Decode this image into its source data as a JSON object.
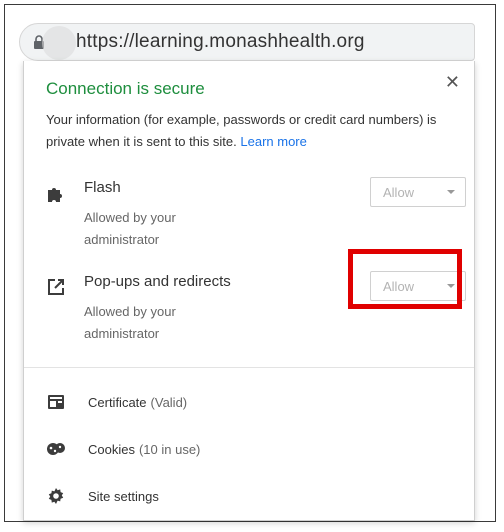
{
  "url": "https://learning.monashhealth.org",
  "panel": {
    "title": "Connection is secure",
    "description": "Your information (for example, passwords or credit card numbers) is private when it is sent to this site.",
    "learn_more": "Learn more",
    "close_glyph": "✕"
  },
  "permissions": [
    {
      "name": "Flash",
      "icon": "puzzle-piece-icon",
      "sub": "Allowed by your administrator",
      "value": "Allow"
    },
    {
      "name": "Pop-ups and redirects",
      "icon": "external-link-icon",
      "sub": "Allowed by your administrator",
      "value": "Allow"
    }
  ],
  "links": [
    {
      "label": "Certificate",
      "detail": "(Valid)",
      "icon": "certificate-icon"
    },
    {
      "label": "Cookies",
      "detail": "(10 in use)",
      "icon": "cookie-icon"
    },
    {
      "label": "Site settings",
      "detail": "",
      "icon": "gear-icon"
    }
  ],
  "colors": {
    "secure_green": "#1e8e3e",
    "link_blue": "#1a73e8",
    "highlight_red": "#e00000"
  }
}
